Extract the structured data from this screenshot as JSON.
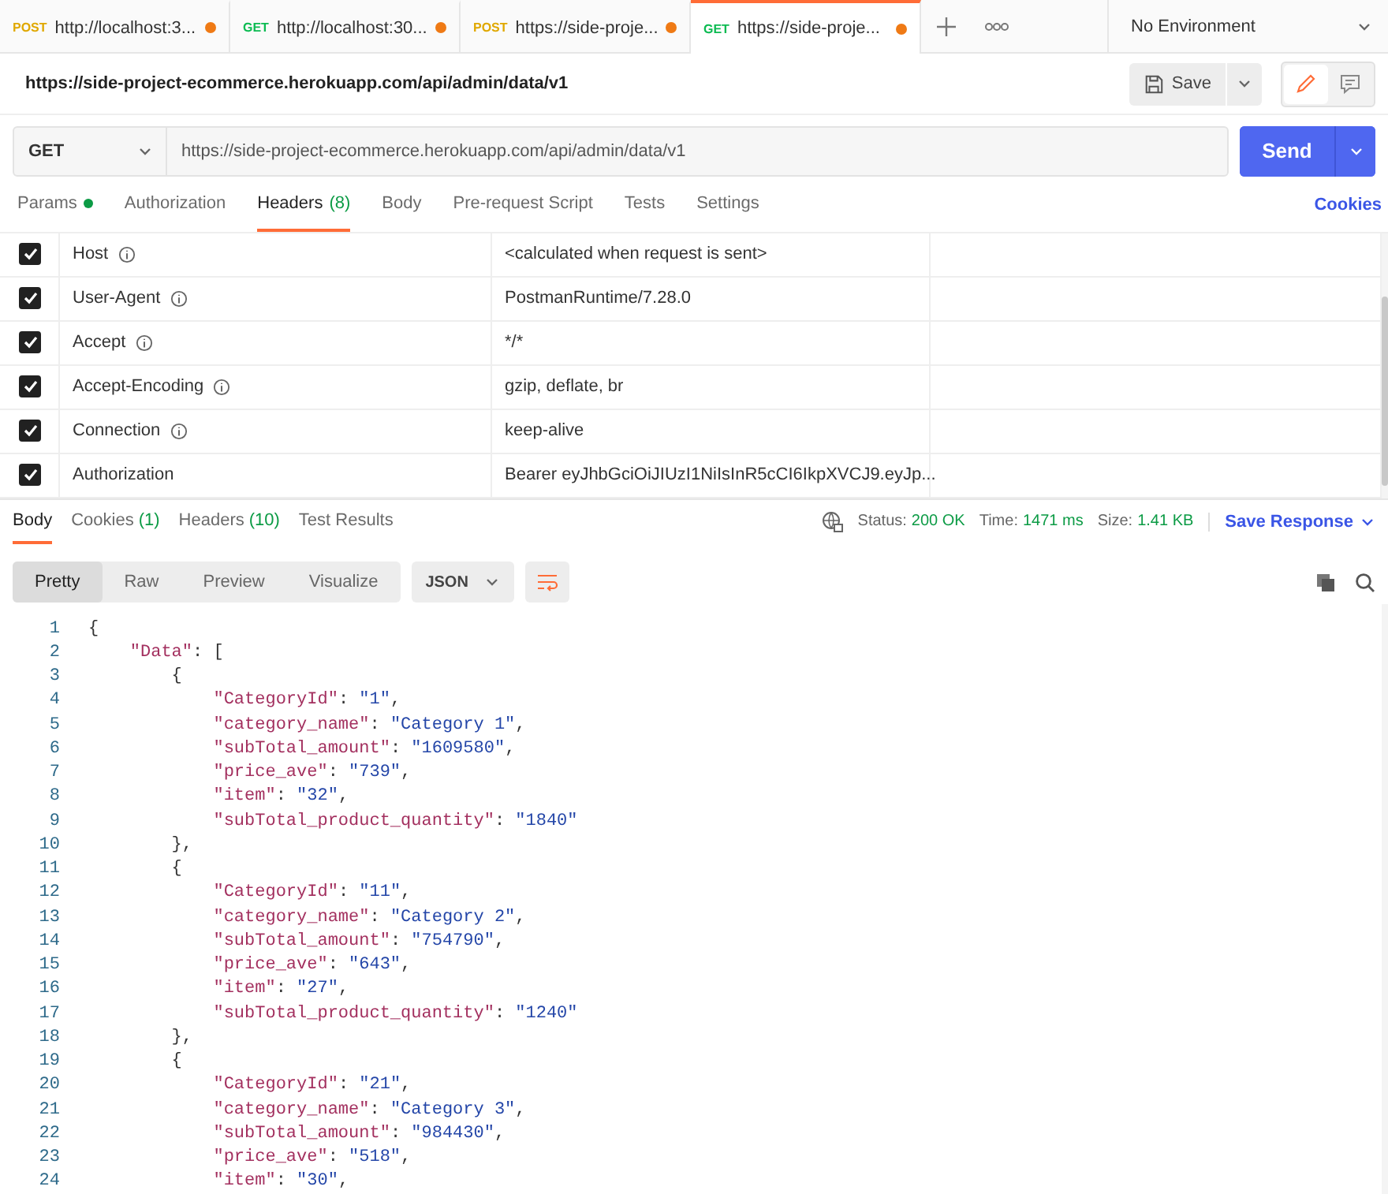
{
  "tabs": [
    {
      "method": "POST",
      "url": "http://localhost:3...",
      "unsaved": true,
      "selected": false
    },
    {
      "method": "GET",
      "url": "http://localhost:30...",
      "unsaved": true,
      "selected": false
    },
    {
      "method": "POST",
      "url": "https://side-proje...",
      "unsaved": true,
      "selected": false
    },
    {
      "method": "GET",
      "url": "https://side-proje...",
      "unsaved": true,
      "selected": true
    }
  ],
  "environment": "No Environment",
  "request_title": "https://side-project-ecommerce.herokuapp.com/api/admin/data/v1",
  "save_button": "Save",
  "method": "GET",
  "url": "https://side-project-ecommerce.herokuapp.com/api/admin/data/v1",
  "send_button": "Send",
  "request_tabs": [
    {
      "label": "Params",
      "dot": true,
      "selected": false
    },
    {
      "label": "Authorization",
      "dot": false,
      "selected": false
    },
    {
      "label": "Headers",
      "count": "(8)",
      "dot": false,
      "selected": true
    },
    {
      "label": "Body",
      "dot": false,
      "selected": false
    },
    {
      "label": "Pre-request Script",
      "dot": false,
      "selected": false
    },
    {
      "label": "Tests",
      "dot": false,
      "selected": false
    },
    {
      "label": "Settings",
      "dot": false,
      "selected": false
    }
  ],
  "cookies_link": "Cookies",
  "headers": [
    {
      "checked": true,
      "key": "Host",
      "info": true,
      "value": "<calculated when request is sent>"
    },
    {
      "checked": true,
      "key": "User-Agent",
      "info": true,
      "value": "PostmanRuntime/7.28.0"
    },
    {
      "checked": true,
      "key": "Accept",
      "info": true,
      "value": "*/*"
    },
    {
      "checked": true,
      "key": "Accept-Encoding",
      "info": true,
      "value": "gzip, deflate, br"
    },
    {
      "checked": true,
      "key": "Connection",
      "info": true,
      "value": "keep-alive"
    },
    {
      "checked": true,
      "key": "Authorization",
      "info": false,
      "value": "Bearer eyJhbGciOiJIUzI1NiIsInR5cCI6IkpXVCJ9.eyJp..."
    }
  ],
  "response_tabs": [
    {
      "label": "Body",
      "selected": true
    },
    {
      "label": "Cookies",
      "count": "(1)",
      "selected": false
    },
    {
      "label": "Headers",
      "count": "(10)",
      "selected": false
    },
    {
      "label": "Test Results",
      "selected": false
    }
  ],
  "status": [
    {
      "label": "Status:",
      "value": "200 OK"
    },
    {
      "label": "Time:",
      "value": "1471 ms"
    },
    {
      "label": "Size:",
      "value": "1.41 KB"
    }
  ],
  "save_response": "Save Response",
  "view_modes": [
    {
      "label": "Pretty",
      "selected": true
    },
    {
      "label": "Raw",
      "selected": false
    },
    {
      "label": "Preview",
      "selected": false
    },
    {
      "label": "Visualize",
      "selected": false
    }
  ],
  "format": "JSON",
  "code_lines": [
    {
      "number": "1",
      "tokens": [
        {
          "kind": "punct",
          "text": "{"
        }
      ]
    },
    {
      "number": "2",
      "tokens": [
        {
          "kind": "key",
          "text": "    \"Data\""
        },
        {
          "kind": "punct",
          "text": ": ["
        }
      ]
    },
    {
      "number": "3",
      "tokens": [
        {
          "kind": "punct",
          "text": "        {"
        }
      ]
    },
    {
      "number": "4",
      "tokens": [
        {
          "kind": "key",
          "text": "            \"CategoryId\""
        },
        {
          "kind": "punct",
          "text": ": "
        },
        {
          "kind": "string",
          "text": "\"1\""
        },
        {
          "kind": "punct",
          "text": ","
        }
      ]
    },
    {
      "number": "5",
      "tokens": [
        {
          "kind": "key",
          "text": "            \"category_name\""
        },
        {
          "kind": "punct",
          "text": ": "
        },
        {
          "kind": "string",
          "text": "\"Category 1\""
        },
        {
          "kind": "punct",
          "text": ","
        }
      ]
    },
    {
      "number": "6",
      "tokens": [
        {
          "kind": "key",
          "text": "            \"subTotal_amount\""
        },
        {
          "kind": "punct",
          "text": ": "
        },
        {
          "kind": "string",
          "text": "\"1609580\""
        },
        {
          "kind": "punct",
          "text": ","
        }
      ]
    },
    {
      "number": "7",
      "tokens": [
        {
          "kind": "key",
          "text": "            \"price_ave\""
        },
        {
          "kind": "punct",
          "text": ": "
        },
        {
          "kind": "string",
          "text": "\"739\""
        },
        {
          "kind": "punct",
          "text": ","
        }
      ]
    },
    {
      "number": "8",
      "tokens": [
        {
          "kind": "key",
          "text": "            \"item\""
        },
        {
          "kind": "punct",
          "text": ": "
        },
        {
          "kind": "string",
          "text": "\"32\""
        },
        {
          "kind": "punct",
          "text": ","
        }
      ]
    },
    {
      "number": "9",
      "tokens": [
        {
          "kind": "key",
          "text": "            \"subTotal_product_quantity\""
        },
        {
          "kind": "punct",
          "text": ": "
        },
        {
          "kind": "string",
          "text": "\"1840\""
        }
      ]
    },
    {
      "number": "10",
      "tokens": [
        {
          "kind": "punct",
          "text": "        },"
        }
      ]
    },
    {
      "number": "11",
      "tokens": [
        {
          "kind": "punct",
          "text": "        {"
        }
      ]
    },
    {
      "number": "12",
      "tokens": [
        {
          "kind": "key",
          "text": "            \"CategoryId\""
        },
        {
          "kind": "punct",
          "text": ": "
        },
        {
          "kind": "string",
          "text": "\"11\""
        },
        {
          "kind": "punct",
          "text": ","
        }
      ]
    },
    {
      "number": "13",
      "tokens": [
        {
          "kind": "key",
          "text": "            \"category_name\""
        },
        {
          "kind": "punct",
          "text": ": "
        },
        {
          "kind": "string",
          "text": "\"Category 2\""
        },
        {
          "kind": "punct",
          "text": ","
        }
      ]
    },
    {
      "number": "14",
      "tokens": [
        {
          "kind": "key",
          "text": "            \"subTotal_amount\""
        },
        {
          "kind": "punct",
          "text": ": "
        },
        {
          "kind": "string",
          "text": "\"754790\""
        },
        {
          "kind": "punct",
          "text": ","
        }
      ]
    },
    {
      "number": "15",
      "tokens": [
        {
          "kind": "key",
          "text": "            \"price_ave\""
        },
        {
          "kind": "punct",
          "text": ": "
        },
        {
          "kind": "string",
          "text": "\"643\""
        },
        {
          "kind": "punct",
          "text": ","
        }
      ]
    },
    {
      "number": "16",
      "tokens": [
        {
          "kind": "key",
          "text": "            \"item\""
        },
        {
          "kind": "punct",
          "text": ": "
        },
        {
          "kind": "string",
          "text": "\"27\""
        },
        {
          "kind": "punct",
          "text": ","
        }
      ]
    },
    {
      "number": "17",
      "tokens": [
        {
          "kind": "key",
          "text": "            \"subTotal_product_quantity\""
        },
        {
          "kind": "punct",
          "text": ": "
        },
        {
          "kind": "string",
          "text": "\"1240\""
        }
      ]
    },
    {
      "number": "18",
      "tokens": [
        {
          "kind": "punct",
          "text": "        },"
        }
      ]
    },
    {
      "number": "19",
      "tokens": [
        {
          "kind": "punct",
          "text": "        {"
        }
      ]
    },
    {
      "number": "20",
      "tokens": [
        {
          "kind": "key",
          "text": "            \"CategoryId\""
        },
        {
          "kind": "punct",
          "text": ": "
        },
        {
          "kind": "string",
          "text": "\"21\""
        },
        {
          "kind": "punct",
          "text": ","
        }
      ]
    },
    {
      "number": "21",
      "tokens": [
        {
          "kind": "key",
          "text": "            \"category_name\""
        },
        {
          "kind": "punct",
          "text": ": "
        },
        {
          "kind": "string",
          "text": "\"Category 3\""
        },
        {
          "kind": "punct",
          "text": ","
        }
      ]
    },
    {
      "number": "22",
      "tokens": [
        {
          "kind": "key",
          "text": "            \"subTotal_amount\""
        },
        {
          "kind": "punct",
          "text": ": "
        },
        {
          "kind": "string",
          "text": "\"984430\""
        },
        {
          "kind": "punct",
          "text": ","
        }
      ]
    },
    {
      "number": "23",
      "tokens": [
        {
          "kind": "key",
          "text": "            \"price_ave\""
        },
        {
          "kind": "punct",
          "text": ": "
        },
        {
          "kind": "string",
          "text": "\"518\""
        },
        {
          "kind": "punct",
          "text": ","
        }
      ]
    },
    {
      "number": "24",
      "tokens": [
        {
          "kind": "key",
          "text": "            \"item\""
        },
        {
          "kind": "punct",
          "text": ": "
        },
        {
          "kind": "string",
          "text": "\"30\""
        },
        {
          "kind": "punct",
          "text": ","
        }
      ]
    }
  ]
}
